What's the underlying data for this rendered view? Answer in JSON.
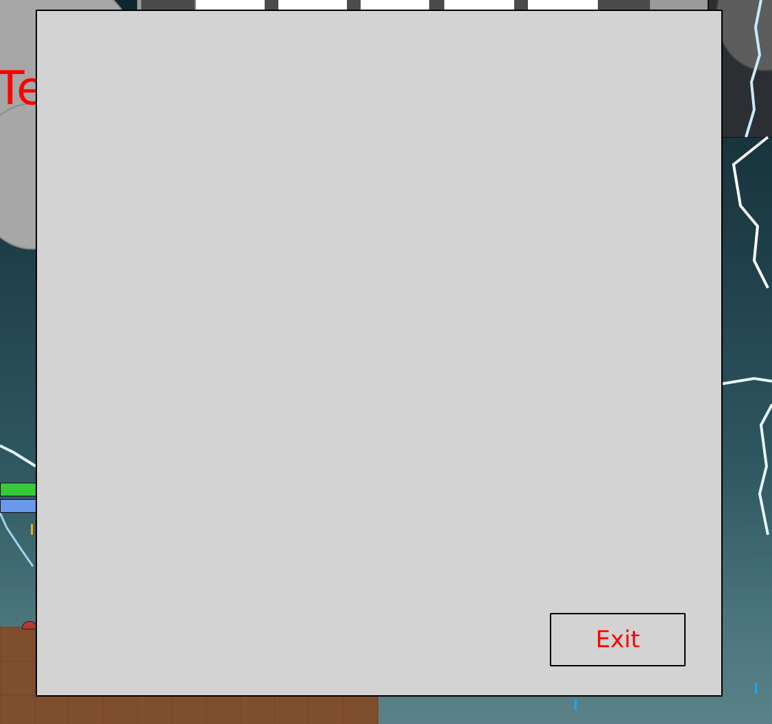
{
  "background": {
    "title_fragment": "Te",
    "colors": {
      "sky_top": "#10262f",
      "sky_bottom": "#5a8288",
      "ground": "#7f4e2c",
      "health": "#35c93b",
      "mana": "#6a98ea",
      "lightning": "#dff4ff",
      "title_text": "#ff0000"
    }
  },
  "hud": {
    "health_fraction": 1.0,
    "mana_fraction": 1.0
  },
  "modal": {
    "background": "#d3d3d3",
    "exit_button_label": "Exit",
    "exit_button_color": "#ff0000"
  }
}
